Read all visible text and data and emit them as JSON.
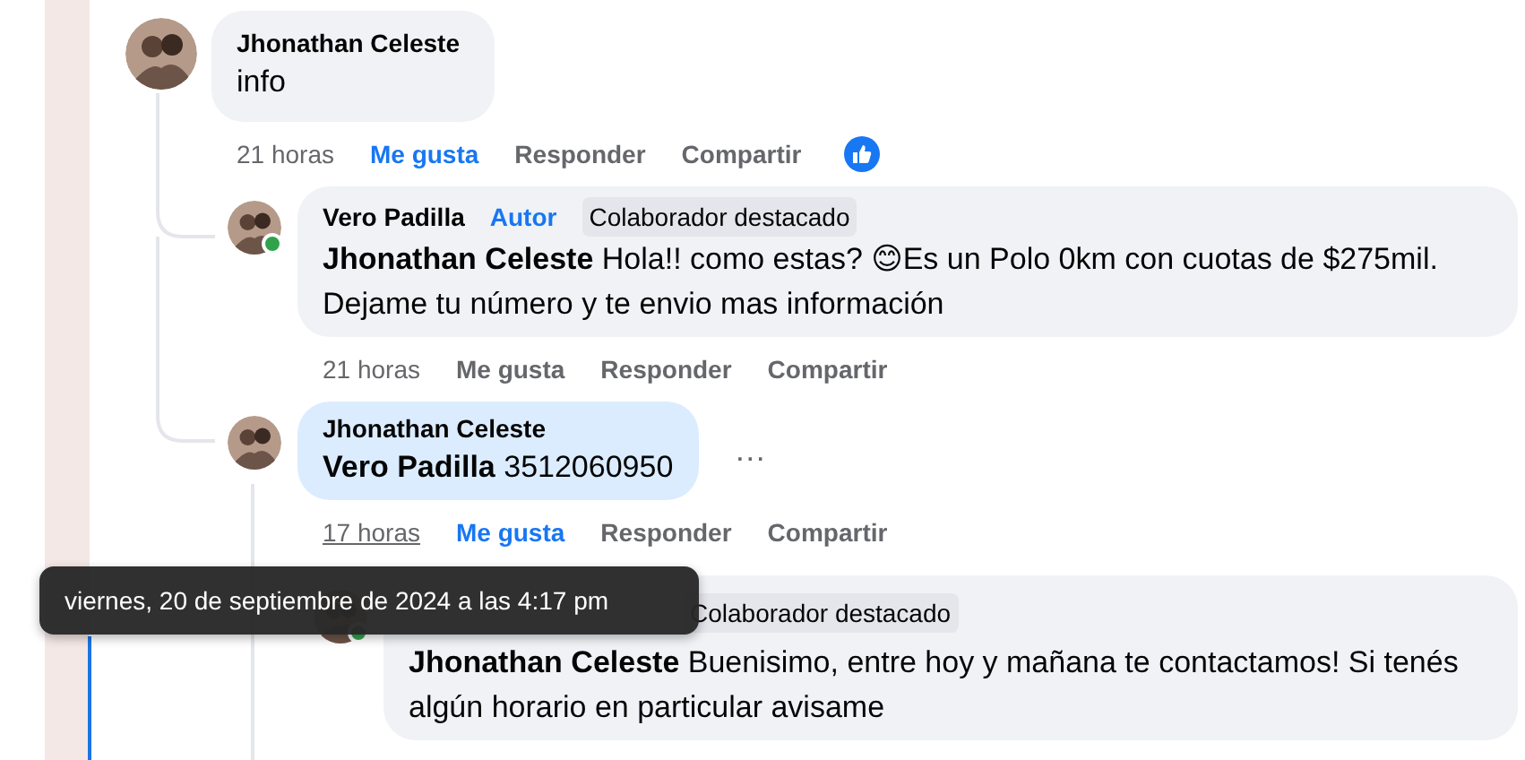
{
  "comments": [
    {
      "author": "Jhonathan Celeste",
      "text": "info",
      "time": "21 horas",
      "like_label": "Me gusta",
      "liked": true,
      "reply_label": "Responder",
      "share_label": "Compartir",
      "reaction": true,
      "children": [
        {
          "author": "Vero Padilla",
          "badges": [
            {
              "text": "Autor",
              "kind": "author"
            },
            {
              "text": "Colaborador destacado",
              "kind": "featured"
            }
          ],
          "text": "**Jhonathan Celeste** Hola!! como estas? 😊Es un Polo 0km con cuotas de $275mil. Dejame tu número y te envio mas información",
          "time": "21 horas",
          "like_label": "Me gusta",
          "liked": false,
          "reply_label": "Responder",
          "share_label": "Compartir",
          "online": true
        },
        {
          "author": "Jhonathan Celeste",
          "text": "**Vero Padilla** 3512060950",
          "time": "17 horas",
          "time_underlined": true,
          "like_label": "Me gusta",
          "liked": true,
          "reply_label": "Responder",
          "share_label": "Compartir",
          "highlighted": true,
          "more": "…",
          "children": [
            {
              "badges": [
                {
                  "text": "Colaborador destacado",
                  "kind": "featured"
                }
              ],
              "text": "**Jhonathan Celeste** Buenisimo, entre hoy y mañana te contactamos! Si tenés algún horario en particular avisame",
              "online": true
            }
          ]
        }
      ]
    }
  ],
  "tooltip": "viernes, 20 de septiembre de 2024 a las 4:17 pm"
}
